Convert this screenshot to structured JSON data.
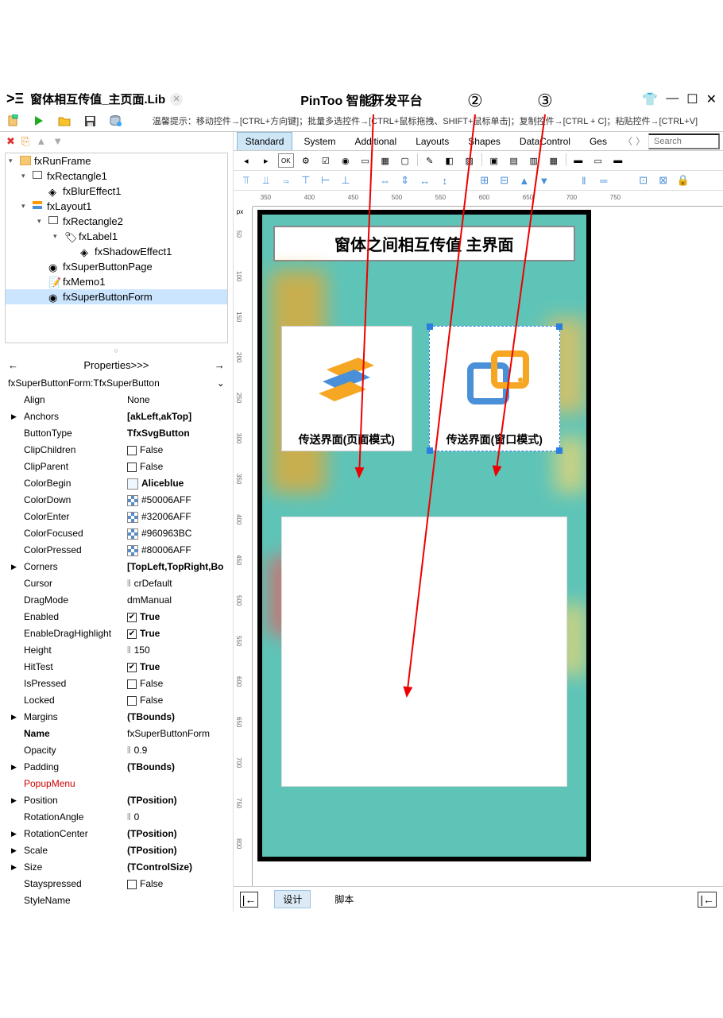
{
  "annotations": {
    "n1": "①",
    "n2": "②",
    "n3": "③"
  },
  "titlebar": {
    "file": "窗体相互传值_主页面.Lib",
    "app": "PinToo 智能开发平台"
  },
  "hint": "温馨提示：移动控件→[CTRL+方向键]；批量多选控件→[CTRL+鼠标拖拽、SHIFT+鼠标单击]；复制控件→[CTRL + C]；粘贴控件→[CTRL+V]",
  "tree": {
    "n0": "fxRunFrame",
    "n1": "fxRectangle1",
    "n2": "fxBlurEffect1",
    "n3": "fxLayout1",
    "n4": "fxRectangle2",
    "n5": "fxLabel1",
    "n6": "fxShadowEffect1",
    "n7": "fxSuperButtonPage",
    "n8": "fxMemo1",
    "n9": "fxSuperButtonForm"
  },
  "props_header": "Properties>>>",
  "selector": "fxSuperButtonForm:TfxSuperButton",
  "props": [
    {
      "n": "Align",
      "v": "None"
    },
    {
      "n": "Anchors",
      "v": "[akLeft,akTop]",
      "e": true,
      "b": true
    },
    {
      "n": "ButtonType",
      "v": "TfxSvgButton",
      "b": true
    },
    {
      "n": "ClipChildren",
      "v": "False",
      "cb": false
    },
    {
      "n": "ClipParent",
      "v": "False",
      "cb": false
    },
    {
      "n": "ColorBegin",
      "v": "Aliceblue",
      "sw": "#f0f8ff",
      "b": true
    },
    {
      "n": "ColorDown",
      "v": "#50006AFF",
      "sw": "checker"
    },
    {
      "n": "ColorEnter",
      "v": "#32006AFF",
      "sw": "checker"
    },
    {
      "n": "ColorFocused",
      "v": "#960963BC",
      "sw": "checker"
    },
    {
      "n": "ColorPressed",
      "v": "#80006AFF",
      "sw": "checker"
    },
    {
      "n": "Corners",
      "v": "[TopLeft,TopRight,Bo",
      "e": true,
      "b": true
    },
    {
      "n": "Cursor",
      "v": "crDefault",
      "ic": "cursor"
    },
    {
      "n": "DragMode",
      "v": "dmManual"
    },
    {
      "n": "Enabled",
      "v": "True",
      "cb": true,
      "b": true
    },
    {
      "n": "EnableDragHighlight",
      "v": "True",
      "cb": true,
      "b": true
    },
    {
      "n": "Height",
      "v": "150",
      "ic": "h"
    },
    {
      "n": "HitTest",
      "v": "True",
      "cb": true,
      "b": true
    },
    {
      "n": "IsPressed",
      "v": "False",
      "cb": false
    },
    {
      "n": "Locked",
      "v": "False",
      "cb": false
    },
    {
      "n": "Margins",
      "v": "(TBounds)",
      "e": true,
      "b": true
    },
    {
      "n": "Name",
      "v": "fxSuperButtonForm",
      "nb": true
    },
    {
      "n": "Opacity",
      "v": "0.9",
      "ic": "h"
    },
    {
      "n": "Padding",
      "v": "(TBounds)",
      "e": true,
      "b": true
    },
    {
      "n": "PopupMenu",
      "v": "",
      "red": true
    },
    {
      "n": "Position",
      "v": "(TPosition)",
      "e": true,
      "b": true
    },
    {
      "n": "RotationAngle",
      "v": "0",
      "ic": "h"
    },
    {
      "n": "RotationCenter",
      "v": "(TPosition)",
      "e": true,
      "b": true
    },
    {
      "n": "Scale",
      "v": "(TPosition)",
      "e": true,
      "b": true
    },
    {
      "n": "Size",
      "v": "(TControlSize)",
      "e": true,
      "b": true
    },
    {
      "n": "Stayspressed",
      "v": "False",
      "cb": false
    },
    {
      "n": "StyleName",
      "v": ""
    }
  ],
  "tabs": [
    "Standard",
    "System",
    "Additional",
    "Layouts",
    "Shapes",
    "DataControl",
    "Ges"
  ],
  "search_placeholder": "Search",
  "ruler_unit": "px",
  "ruler_h": [
    "350",
    "400",
    "450",
    "500",
    "550",
    "600",
    "650",
    "700",
    "750"
  ],
  "ruler_v": [
    "50",
    "100",
    "150",
    "200",
    "250",
    "300",
    "350",
    "400",
    "450",
    "500",
    "550",
    "600",
    "650",
    "700",
    "750",
    "800"
  ],
  "screen": {
    "header": "窗体之间相互传值 主界面",
    "btn1": "传送界面(页面模式)",
    "btn2": "传送界面(窗口模式)"
  },
  "bottom": {
    "design": "设计",
    "script": "脚本"
  }
}
